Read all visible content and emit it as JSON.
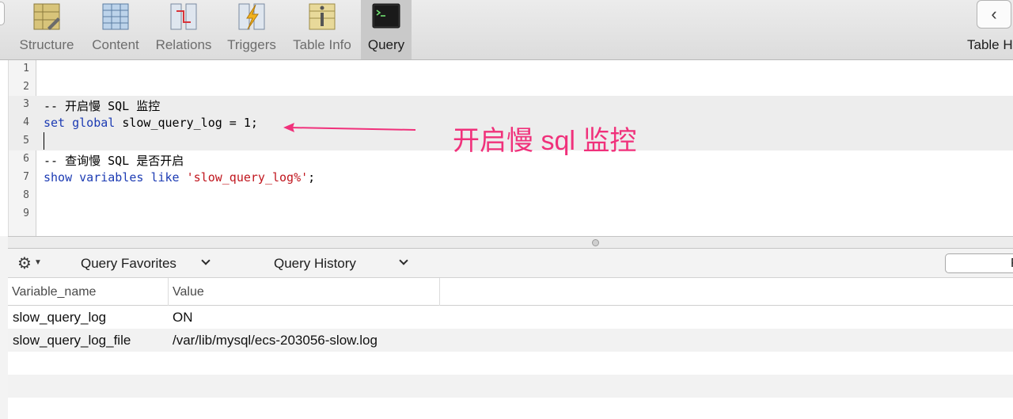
{
  "toolbar": {
    "tabs": [
      {
        "label": "Structure",
        "icon": "structure-icon"
      },
      {
        "label": "Content",
        "icon": "content-icon"
      },
      {
        "label": "Relations",
        "icon": "relations-icon"
      },
      {
        "label": "Triggers",
        "icon": "triggers-icon"
      },
      {
        "label": "Table Info",
        "icon": "table-info-icon"
      },
      {
        "label": "Query",
        "icon": "query-terminal-icon",
        "active": true
      }
    ],
    "right_label": "Table H",
    "back_glyph": "‹"
  },
  "editor": {
    "line_numbers": [
      "1",
      "2",
      "3",
      "4",
      "5",
      "6",
      "7",
      "8",
      "9"
    ],
    "line3_comment": "-- 开启慢 SQL 监控",
    "line4": {
      "kw1": "set",
      "kw2": "global",
      "rest": " slow_query_log = 1;"
    },
    "line6_comment": "-- 查询慢 SQL 是否开启",
    "line7": {
      "kw1": "show",
      "kw2": "variables",
      "kw3": "like",
      "str": "'slow_query_log%'",
      "end": ";"
    },
    "annotation": "开启慢 sql 监控",
    "annotation_color": "#f0317b"
  },
  "query_bar": {
    "favorites_label": "Query Favorites",
    "history_label": "Query History",
    "run_label": "R"
  },
  "results": {
    "columns": [
      "Variable_name",
      "Value"
    ],
    "rows": [
      [
        "slow_query_log",
        "ON"
      ],
      [
        "slow_query_log_file",
        "/var/lib/mysql/ecs-203056-slow.log"
      ]
    ]
  },
  "colors": {
    "keyword": "#1c3bb3",
    "comment": "#1a8a1a",
    "string": "#c0151d",
    "active_tab": "#c9c9c9"
  }
}
